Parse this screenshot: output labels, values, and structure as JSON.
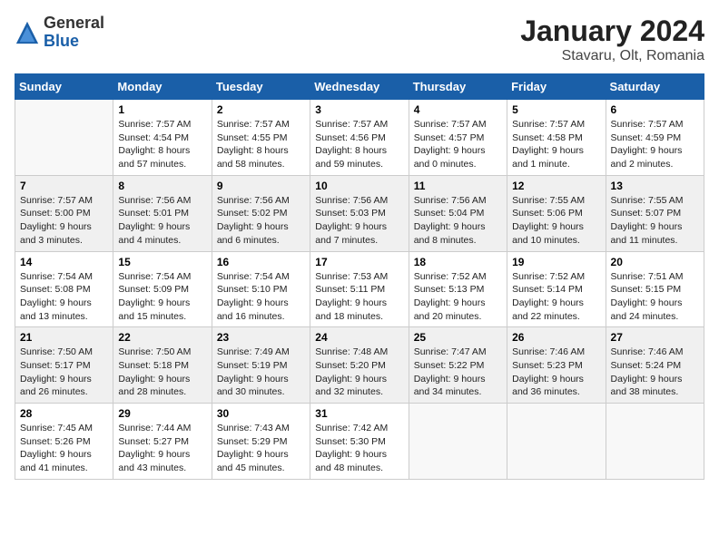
{
  "logo": {
    "general": "General",
    "blue": "Blue"
  },
  "header": {
    "month": "January 2024",
    "location": "Stavaru, Olt, Romania"
  },
  "days_of_week": [
    "Sunday",
    "Monday",
    "Tuesday",
    "Wednesday",
    "Thursday",
    "Friday",
    "Saturday"
  ],
  "weeks": [
    [
      {
        "day": "",
        "info": ""
      },
      {
        "day": "1",
        "info": "Sunrise: 7:57 AM\nSunset: 4:54 PM\nDaylight: 8 hours\nand 57 minutes."
      },
      {
        "day": "2",
        "info": "Sunrise: 7:57 AM\nSunset: 4:55 PM\nDaylight: 8 hours\nand 58 minutes."
      },
      {
        "day": "3",
        "info": "Sunrise: 7:57 AM\nSunset: 4:56 PM\nDaylight: 8 hours\nand 59 minutes."
      },
      {
        "day": "4",
        "info": "Sunrise: 7:57 AM\nSunset: 4:57 PM\nDaylight: 9 hours\nand 0 minutes."
      },
      {
        "day": "5",
        "info": "Sunrise: 7:57 AM\nSunset: 4:58 PM\nDaylight: 9 hours\nand 1 minute."
      },
      {
        "day": "6",
        "info": "Sunrise: 7:57 AM\nSunset: 4:59 PM\nDaylight: 9 hours\nand 2 minutes."
      }
    ],
    [
      {
        "day": "7",
        "info": "Sunrise: 7:57 AM\nSunset: 5:00 PM\nDaylight: 9 hours\nand 3 minutes."
      },
      {
        "day": "8",
        "info": "Sunrise: 7:56 AM\nSunset: 5:01 PM\nDaylight: 9 hours\nand 4 minutes."
      },
      {
        "day": "9",
        "info": "Sunrise: 7:56 AM\nSunset: 5:02 PM\nDaylight: 9 hours\nand 6 minutes."
      },
      {
        "day": "10",
        "info": "Sunrise: 7:56 AM\nSunset: 5:03 PM\nDaylight: 9 hours\nand 7 minutes."
      },
      {
        "day": "11",
        "info": "Sunrise: 7:56 AM\nSunset: 5:04 PM\nDaylight: 9 hours\nand 8 minutes."
      },
      {
        "day": "12",
        "info": "Sunrise: 7:55 AM\nSunset: 5:06 PM\nDaylight: 9 hours\nand 10 minutes."
      },
      {
        "day": "13",
        "info": "Sunrise: 7:55 AM\nSunset: 5:07 PM\nDaylight: 9 hours\nand 11 minutes."
      }
    ],
    [
      {
        "day": "14",
        "info": "Sunrise: 7:54 AM\nSunset: 5:08 PM\nDaylight: 9 hours\nand 13 minutes."
      },
      {
        "day": "15",
        "info": "Sunrise: 7:54 AM\nSunset: 5:09 PM\nDaylight: 9 hours\nand 15 minutes."
      },
      {
        "day": "16",
        "info": "Sunrise: 7:54 AM\nSunset: 5:10 PM\nDaylight: 9 hours\nand 16 minutes."
      },
      {
        "day": "17",
        "info": "Sunrise: 7:53 AM\nSunset: 5:11 PM\nDaylight: 9 hours\nand 18 minutes."
      },
      {
        "day": "18",
        "info": "Sunrise: 7:52 AM\nSunset: 5:13 PM\nDaylight: 9 hours\nand 20 minutes."
      },
      {
        "day": "19",
        "info": "Sunrise: 7:52 AM\nSunset: 5:14 PM\nDaylight: 9 hours\nand 22 minutes."
      },
      {
        "day": "20",
        "info": "Sunrise: 7:51 AM\nSunset: 5:15 PM\nDaylight: 9 hours\nand 24 minutes."
      }
    ],
    [
      {
        "day": "21",
        "info": "Sunrise: 7:50 AM\nSunset: 5:17 PM\nDaylight: 9 hours\nand 26 minutes."
      },
      {
        "day": "22",
        "info": "Sunrise: 7:50 AM\nSunset: 5:18 PM\nDaylight: 9 hours\nand 28 minutes."
      },
      {
        "day": "23",
        "info": "Sunrise: 7:49 AM\nSunset: 5:19 PM\nDaylight: 9 hours\nand 30 minutes."
      },
      {
        "day": "24",
        "info": "Sunrise: 7:48 AM\nSunset: 5:20 PM\nDaylight: 9 hours\nand 32 minutes."
      },
      {
        "day": "25",
        "info": "Sunrise: 7:47 AM\nSunset: 5:22 PM\nDaylight: 9 hours\nand 34 minutes."
      },
      {
        "day": "26",
        "info": "Sunrise: 7:46 AM\nSunset: 5:23 PM\nDaylight: 9 hours\nand 36 minutes."
      },
      {
        "day": "27",
        "info": "Sunrise: 7:46 AM\nSunset: 5:24 PM\nDaylight: 9 hours\nand 38 minutes."
      }
    ],
    [
      {
        "day": "28",
        "info": "Sunrise: 7:45 AM\nSunset: 5:26 PM\nDaylight: 9 hours\nand 41 minutes."
      },
      {
        "day": "29",
        "info": "Sunrise: 7:44 AM\nSunset: 5:27 PM\nDaylight: 9 hours\nand 43 minutes."
      },
      {
        "day": "30",
        "info": "Sunrise: 7:43 AM\nSunset: 5:29 PM\nDaylight: 9 hours\nand 45 minutes."
      },
      {
        "day": "31",
        "info": "Sunrise: 7:42 AM\nSunset: 5:30 PM\nDaylight: 9 hours\nand 48 minutes."
      },
      {
        "day": "",
        "info": ""
      },
      {
        "day": "",
        "info": ""
      },
      {
        "day": "",
        "info": ""
      }
    ]
  ]
}
